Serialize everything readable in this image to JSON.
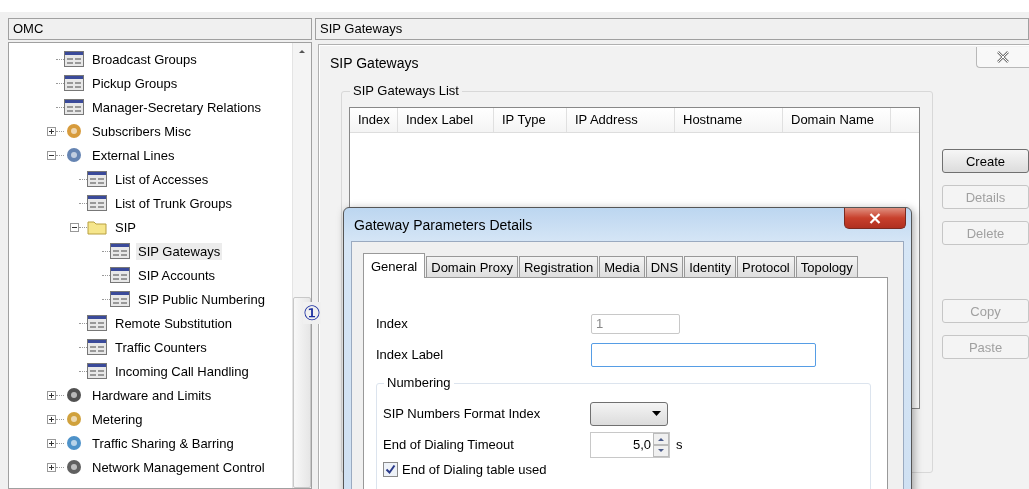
{
  "left_panel": {
    "title": "OMC"
  },
  "tree": {
    "items": [
      {
        "label": "Broadcast Groups",
        "kind": "list",
        "selected": false
      },
      {
        "label": "Pickup Groups",
        "kind": "list",
        "selected": false
      },
      {
        "label": "Manager-Secretary Relations",
        "kind": "list",
        "selected": false
      },
      {
        "label": "Subscribers Misc",
        "kind": "subscribers",
        "expanded": false,
        "selected": false
      },
      {
        "label": "External Lines",
        "kind": "lines",
        "expanded": true,
        "selected": false,
        "children": [
          {
            "label": "List of Accesses",
            "kind": "list",
            "selected": false
          },
          {
            "label": "List of Trunk Groups",
            "kind": "list",
            "selected": false
          },
          {
            "label": "SIP",
            "kind": "folder",
            "expanded": true,
            "selected": false,
            "children": [
              {
                "label": "SIP Gateways",
                "kind": "list",
                "selected": true
              },
              {
                "label": "SIP Accounts",
                "kind": "list",
                "selected": false
              },
              {
                "label": "SIP Public Numbering",
                "kind": "list",
                "selected": false
              }
            ]
          },
          {
            "label": "Remote Substitution",
            "kind": "list",
            "selected": false
          },
          {
            "label": "Traffic Counters",
            "kind": "list",
            "selected": false
          },
          {
            "label": "Incoming Call Handling",
            "kind": "list",
            "selected": false
          }
        ]
      },
      {
        "label": "Hardware and Limits",
        "kind": "hardware",
        "expanded": false,
        "selected": false
      },
      {
        "label": "Metering",
        "kind": "metering",
        "expanded": false,
        "selected": false
      },
      {
        "label": "Traffic Sharing & Barring",
        "kind": "traffic",
        "expanded": false,
        "selected": false
      },
      {
        "label": "Network Management Control",
        "kind": "network",
        "expanded": false,
        "selected": false
      }
    ]
  },
  "callout_marker": "①",
  "right_panel": {
    "title": "SIP Gateways"
  },
  "gateways_window": {
    "title": "SIP Gateways",
    "list_title": "SIP Gateways List",
    "table": {
      "columns": [
        "Index",
        "Index Label",
        "IP Type",
        "IP Address",
        "Hostname",
        "Domain Name"
      ]
    },
    "buttons": [
      {
        "label": "Create",
        "disabled": false
      },
      {
        "label": "Details",
        "disabled": true
      },
      {
        "label": "Delete",
        "disabled": true
      },
      {
        "label": "Copy",
        "disabled": true
      },
      {
        "label": "Paste",
        "disabled": true
      }
    ]
  },
  "dialog": {
    "title": "Gateway Parameters Details",
    "tabs": [
      {
        "label": "General",
        "selected": true
      },
      {
        "label": "Domain Proxy",
        "selected": false
      },
      {
        "label": "Registration",
        "selected": false
      },
      {
        "label": "Media",
        "selected": false
      },
      {
        "label": "DNS",
        "selected": false
      },
      {
        "label": "Identity",
        "selected": false
      },
      {
        "label": "Protocol",
        "selected": false
      },
      {
        "label": "Topology",
        "selected": false
      }
    ],
    "index": {
      "label": "Index",
      "value": "1",
      "disabled": true
    },
    "index_label": {
      "label": "Index Label",
      "focused": true
    },
    "numbering": {
      "title": "Numbering",
      "format_index": {
        "label": "SIP Numbers Format Index"
      },
      "timeout": {
        "label": "End of Dialing Timeout",
        "value": "5,0",
        "unit": "s"
      },
      "table_used": {
        "label": "End of Dialing table used",
        "checked": true
      }
    }
  }
}
